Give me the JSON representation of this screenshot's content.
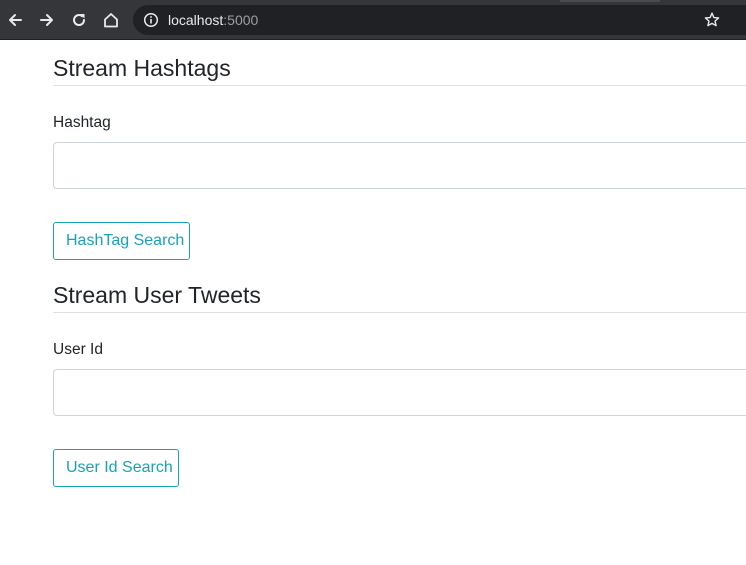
{
  "browser": {
    "url_host": "localhost",
    "url_port": ":5000",
    "icons": [
      "back-icon",
      "forward-icon",
      "reload-icon",
      "home-icon",
      "info-icon",
      "bookmark-star-icon"
    ]
  },
  "hashtags_section": {
    "title": "Stream Hashtags",
    "field_label": "Hashtag",
    "input_value": "",
    "button_label": "HashTag Search"
  },
  "user_section": {
    "title": "Stream User Tweets",
    "field_label": "User Id",
    "input_value": "",
    "button_label": "User Id Search"
  },
  "colors": {
    "button_accent": "#17a2b8",
    "toolbar_bg": "#35363a",
    "omnibox_bg": "#202124"
  }
}
